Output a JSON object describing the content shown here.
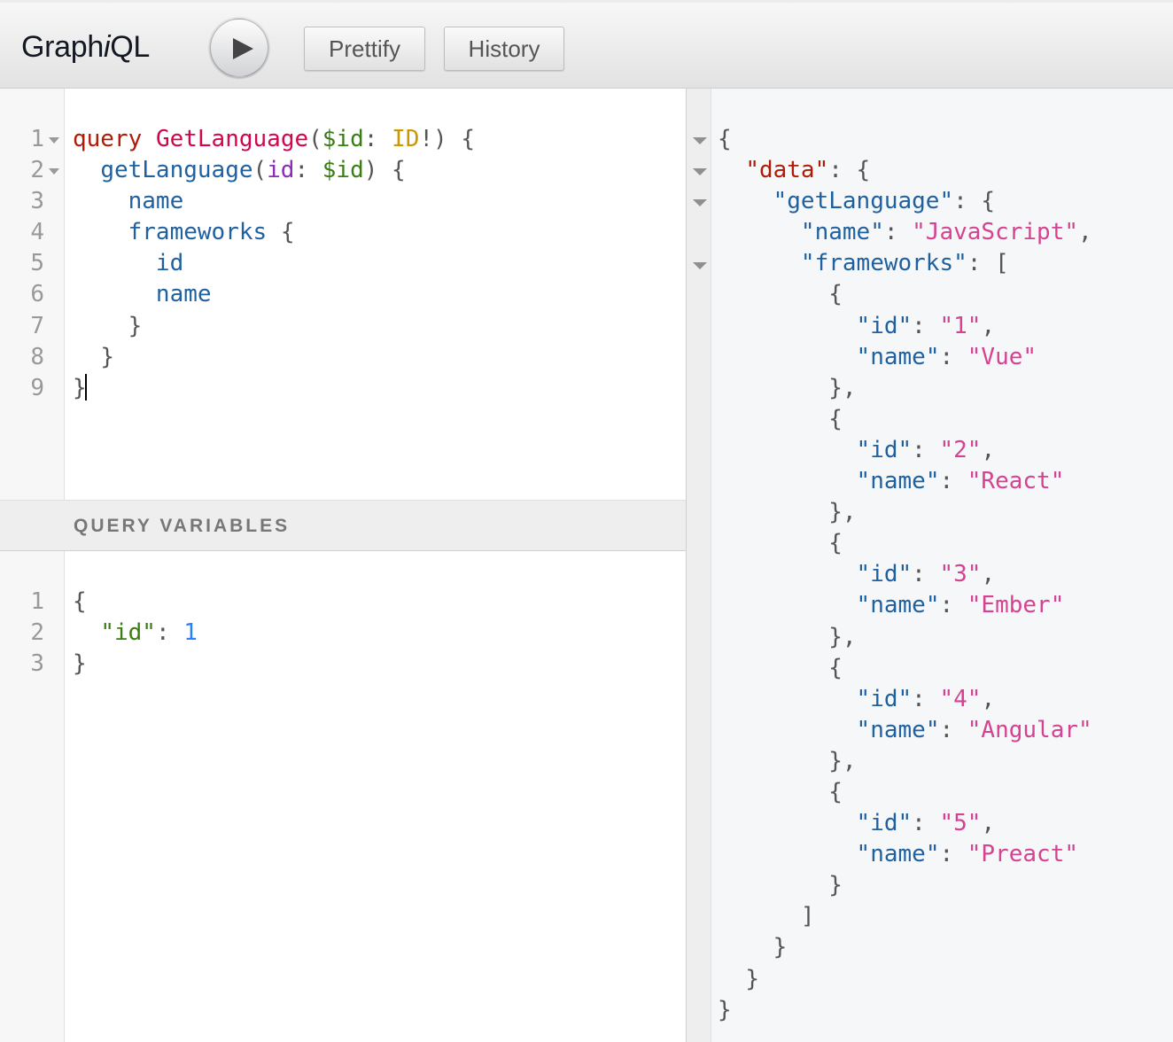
{
  "header": {
    "title_prefix": "Graph",
    "title_italic": "i",
    "title_suffix": "QL",
    "execute_label": "Execute Query",
    "prettify_label": "Prettify",
    "history_label": "History"
  },
  "query_editor": {
    "line_numbers": "1\n2\n3\n4\n5\n6\n7\n8\n9",
    "kw_query": "query",
    "op_name": "GetLanguage",
    "var_id": "$id",
    "type_id": "ID",
    "field_getLanguage": "getLanguage",
    "arg_id": "id",
    "field_name": "name",
    "field_frameworks": "frameworks",
    "field_id": "id"
  },
  "variables_panel": {
    "title": "QUERY VARIABLES",
    "line_numbers": "1\n2\n3",
    "key": "\"id\"",
    "value": "1"
  },
  "result": {
    "data_key": "\"data\"",
    "get_language_key": "\"getLanguage\"",
    "name_key": "\"name\"",
    "name_value": "\"JavaScript\"",
    "frameworks_key": "\"frameworks\"",
    "id_key": "\"id\"",
    "frameworks": [
      {
        "id": "\"1\"",
        "name": "\"Vue\""
      },
      {
        "id": "\"2\"",
        "name": "\"React\""
      },
      {
        "id": "\"3\"",
        "name": "\"Ember\""
      },
      {
        "id": "\"4\"",
        "name": "\"Angular\""
      },
      {
        "id": "\"5\"",
        "name": "\"Preact\""
      }
    ]
  }
}
